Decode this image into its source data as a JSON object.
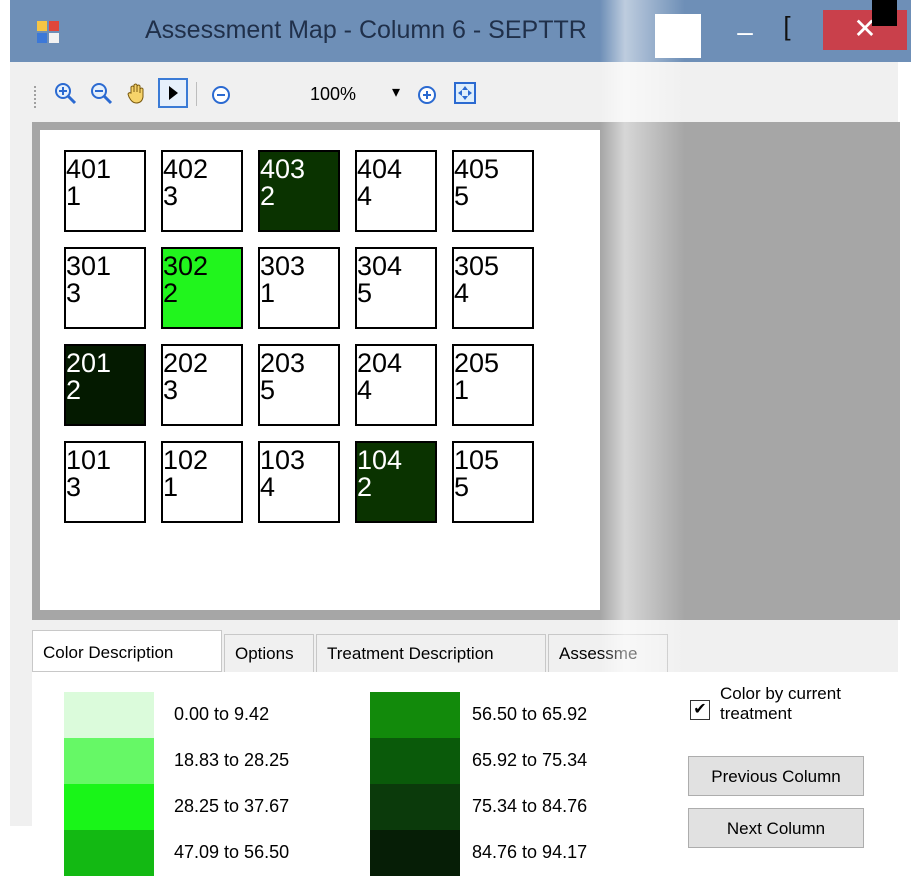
{
  "window": {
    "title": "Assessment Map - Column 6 - SEPTTR",
    "minimize_glyph": "–",
    "restore_glyph": "[",
    "close_glyph": "✕"
  },
  "toolbar": {
    "icons": [
      "zoom-in-icon",
      "zoom-out-icon",
      "pan-hand-icon",
      "pointer-arrow-icon",
      "zoom-minus-icon",
      "zoom-plus-icon",
      "fit-to-window-icon"
    ],
    "zoom_value": "100%",
    "dropdown_glyph": "▾"
  },
  "map": {
    "rows": [
      [
        {
          "plot": "401",
          "treatment": "1",
          "color": "#ffffff"
        },
        {
          "plot": "402",
          "treatment": "3",
          "color": "#ffffff"
        },
        {
          "plot": "403",
          "treatment": "2",
          "color": "#0a3300"
        },
        {
          "plot": "404",
          "treatment": "4",
          "color": "#ffffff"
        },
        {
          "plot": "405",
          "treatment": "5",
          "color": "#ffffff"
        }
      ],
      [
        {
          "plot": "301",
          "treatment": "3",
          "color": "#ffffff"
        },
        {
          "plot": "302",
          "treatment": "2",
          "color": "#21f51d"
        },
        {
          "plot": "303",
          "treatment": "1",
          "color": "#ffffff"
        },
        {
          "plot": "304",
          "treatment": "5",
          "color": "#ffffff"
        },
        {
          "plot": "305",
          "treatment": "4",
          "color": "#ffffff"
        }
      ],
      [
        {
          "plot": "201",
          "treatment": "2",
          "color": "#041a00"
        },
        {
          "plot": "202",
          "treatment": "3",
          "color": "#ffffff"
        },
        {
          "plot": "203",
          "treatment": "5",
          "color": "#ffffff"
        },
        {
          "plot": "204",
          "treatment": "4",
          "color": "#ffffff"
        },
        {
          "plot": "205",
          "treatment": "1",
          "color": "#ffffff"
        }
      ],
      [
        {
          "plot": "101",
          "treatment": "3",
          "color": "#ffffff"
        },
        {
          "plot": "102",
          "treatment": "1",
          "color": "#ffffff"
        },
        {
          "plot": "103",
          "treatment": "4",
          "color": "#ffffff"
        },
        {
          "plot": "104",
          "treatment": "2",
          "color": "#0a3300"
        },
        {
          "plot": "105",
          "treatment": "5",
          "color": "#ffffff"
        }
      ]
    ]
  },
  "tabs": [
    "Color Description",
    "Options",
    "Treatment Description",
    "Assessme"
  ],
  "legend": {
    "left": [
      {
        "range": "0.00 to 9.42",
        "color": "#dbfbdb"
      },
      {
        "range": "18.83 to 28.25",
        "color": "#66f866"
      },
      {
        "range": "28.25 to 37.67",
        "color": "#19f518"
      },
      {
        "range": "47.09 to 56.50",
        "color": "#13b913"
      }
    ],
    "right": [
      {
        "range": "56.50 to 65.92",
        "color": "#128a0b"
      },
      {
        "range": "65.92 to 75.34",
        "color": "#0a5a0a"
      },
      {
        "range": "75.34 to 84.76",
        "color": "#0b3a0b"
      },
      {
        "range": "84.76 to 94.17",
        "color": "#061e06"
      }
    ]
  },
  "controls": {
    "color_by_treatment": {
      "label_line1": "Color by current",
      "label_line2": "treatment",
      "checked": true,
      "check_glyph": "✔"
    },
    "previous_column": "Previous Column",
    "next_column": "Next Column"
  }
}
